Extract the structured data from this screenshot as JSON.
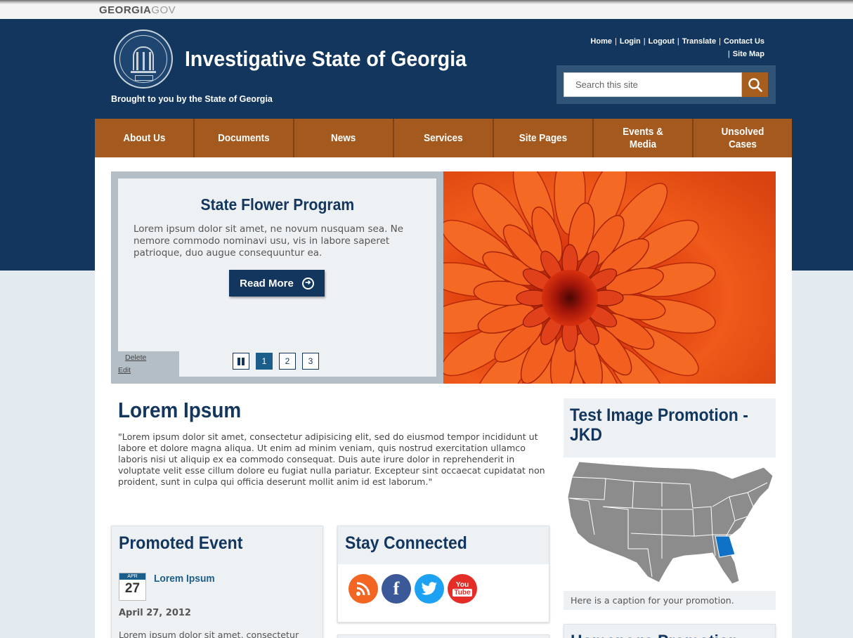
{
  "gov_bar": {
    "brand_bold": "GEORGIA",
    "brand_light": "GOV"
  },
  "header": {
    "title": "Investigative State of Georgia",
    "tagline": "Brought to you by the State of Georgia",
    "utility_links": [
      "Home",
      "Login",
      "Logout",
      "Translate",
      "Contact Us",
      "Site Map"
    ],
    "search": {
      "placeholder": "Search this site"
    }
  },
  "nav": {
    "items": [
      "About Us",
      "Documents",
      "News",
      "Services",
      "Site Pages",
      "Events & Media",
      "Unsolved Cases"
    ]
  },
  "slider": {
    "title": "State Flower Program",
    "text": "Lorem ipsum dolor sit amet, ne novum nusquam sea. Ne nemore commodo nominavi usu, vis in labore saperet patrioque, duo augue consequuntur ea.",
    "button": "Read More",
    "admin": {
      "delete": "Delete",
      "edit": "Edit"
    },
    "pages": [
      "1",
      "2",
      "3"
    ],
    "active_page": "1"
  },
  "intro": {
    "title": "Lorem Ipsum",
    "text": "\"Lorem ipsum dolor sit amet, consectetur adipisicing elit, sed do eiusmod tempor incididunt ut labore et dolore magna aliqua. Ut enim ad minim veniam, quis nostrud exercitation ullamco laboris nisi ut aliquip ex ea commodo consequat. Duis aute irure dolor in reprehenderit in voluptate velit esse cillum dolore eu fugiat nulla pariatur. Excepteur sint occaecat cupidatat non proident, sunt in culpa qui officia deserunt mollit anim id est laborum.\""
  },
  "event": {
    "heading": "Promoted Event",
    "cal_month": "APR",
    "cal_day": "27",
    "link": "Lorem Ipsum",
    "date": "April 27, 2012",
    "text": "Lorem ipsum dolor sit amet, consectetur"
  },
  "social": {
    "heading": "Stay Connected",
    "icons": [
      "rss-icon",
      "facebook-icon",
      "twitter-icon",
      "youtube-icon"
    ],
    "colors": {
      "rss": "#f26522",
      "facebook": "#3b5998",
      "twitter": "#1da1f2",
      "youtube": "#e52d27"
    },
    "youtube_text": [
      "You",
      "Tube"
    ]
  },
  "promo": {
    "heading": "Test Image Promotion - JKD",
    "caption": "Here is a caption for your promotion.",
    "next_heading": "Homepage Promotion"
  },
  "colors": {
    "navy": "#12365d",
    "orange": "#a45a1e",
    "highlight_state": "#0f72c7"
  }
}
